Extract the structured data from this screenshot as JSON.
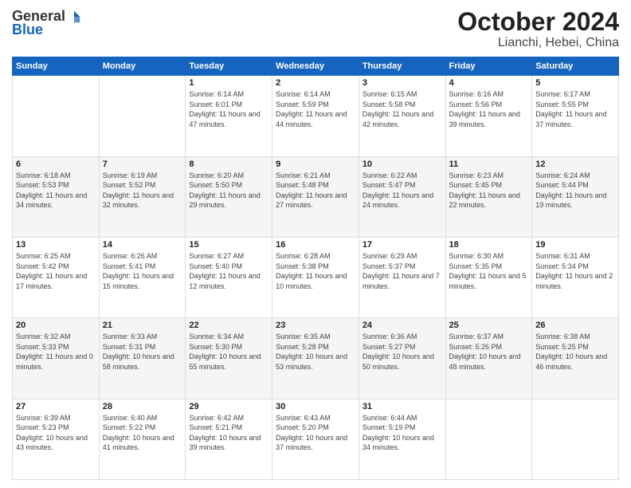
{
  "logo": {
    "general": "General",
    "blue": "Blue"
  },
  "title": "October 2024",
  "subtitle": "Lianchi, Hebei, China",
  "days_header": [
    "Sunday",
    "Monday",
    "Tuesday",
    "Wednesday",
    "Thursday",
    "Friday",
    "Saturday"
  ],
  "weeks": [
    [
      {
        "day": "",
        "info": ""
      },
      {
        "day": "",
        "info": ""
      },
      {
        "day": "1",
        "sunrise": "6:14 AM",
        "sunset": "6:01 PM",
        "daylight": "11 hours and 47 minutes."
      },
      {
        "day": "2",
        "sunrise": "6:14 AM",
        "sunset": "5:59 PM",
        "daylight": "11 hours and 44 minutes."
      },
      {
        "day": "3",
        "sunrise": "6:15 AM",
        "sunset": "5:58 PM",
        "daylight": "11 hours and 42 minutes."
      },
      {
        "day": "4",
        "sunrise": "6:16 AM",
        "sunset": "5:56 PM",
        "daylight": "11 hours and 39 minutes."
      },
      {
        "day": "5",
        "sunrise": "6:17 AM",
        "sunset": "5:55 PM",
        "daylight": "11 hours and 37 minutes."
      }
    ],
    [
      {
        "day": "6",
        "sunrise": "6:18 AM",
        "sunset": "5:53 PM",
        "daylight": "11 hours and 34 minutes."
      },
      {
        "day": "7",
        "sunrise": "6:19 AM",
        "sunset": "5:52 PM",
        "daylight": "11 hours and 32 minutes."
      },
      {
        "day": "8",
        "sunrise": "6:20 AM",
        "sunset": "5:50 PM",
        "daylight": "11 hours and 29 minutes."
      },
      {
        "day": "9",
        "sunrise": "6:21 AM",
        "sunset": "5:48 PM",
        "daylight": "11 hours and 27 minutes."
      },
      {
        "day": "10",
        "sunrise": "6:22 AM",
        "sunset": "5:47 PM",
        "daylight": "11 hours and 24 minutes."
      },
      {
        "day": "11",
        "sunrise": "6:23 AM",
        "sunset": "5:45 PM",
        "daylight": "11 hours and 22 minutes."
      },
      {
        "day": "12",
        "sunrise": "6:24 AM",
        "sunset": "5:44 PM",
        "daylight": "11 hours and 19 minutes."
      }
    ],
    [
      {
        "day": "13",
        "sunrise": "6:25 AM",
        "sunset": "5:42 PM",
        "daylight": "11 hours and 17 minutes."
      },
      {
        "day": "14",
        "sunrise": "6:26 AM",
        "sunset": "5:41 PM",
        "daylight": "11 hours and 15 minutes."
      },
      {
        "day": "15",
        "sunrise": "6:27 AM",
        "sunset": "5:40 PM",
        "daylight": "11 hours and 12 minutes."
      },
      {
        "day": "16",
        "sunrise": "6:28 AM",
        "sunset": "5:38 PM",
        "daylight": "11 hours and 10 minutes."
      },
      {
        "day": "17",
        "sunrise": "6:29 AM",
        "sunset": "5:37 PM",
        "daylight": "11 hours and 7 minutes."
      },
      {
        "day": "18",
        "sunrise": "6:30 AM",
        "sunset": "5:35 PM",
        "daylight": "11 hours and 5 minutes."
      },
      {
        "day": "19",
        "sunrise": "6:31 AM",
        "sunset": "5:34 PM",
        "daylight": "11 hours and 2 minutes."
      }
    ],
    [
      {
        "day": "20",
        "sunrise": "6:32 AM",
        "sunset": "5:33 PM",
        "daylight": "11 hours and 0 minutes."
      },
      {
        "day": "21",
        "sunrise": "6:33 AM",
        "sunset": "5:31 PM",
        "daylight": "10 hours and 58 minutes."
      },
      {
        "day": "22",
        "sunrise": "6:34 AM",
        "sunset": "5:30 PM",
        "daylight": "10 hours and 55 minutes."
      },
      {
        "day": "23",
        "sunrise": "6:35 AM",
        "sunset": "5:28 PM",
        "daylight": "10 hours and 53 minutes."
      },
      {
        "day": "24",
        "sunrise": "6:36 AM",
        "sunset": "5:27 PM",
        "daylight": "10 hours and 50 minutes."
      },
      {
        "day": "25",
        "sunrise": "6:37 AM",
        "sunset": "5:26 PM",
        "daylight": "10 hours and 48 minutes."
      },
      {
        "day": "26",
        "sunrise": "6:38 AM",
        "sunset": "5:25 PM",
        "daylight": "10 hours and 46 minutes."
      }
    ],
    [
      {
        "day": "27",
        "sunrise": "6:39 AM",
        "sunset": "5:23 PM",
        "daylight": "10 hours and 43 minutes."
      },
      {
        "day": "28",
        "sunrise": "6:40 AM",
        "sunset": "5:22 PM",
        "daylight": "10 hours and 41 minutes."
      },
      {
        "day": "29",
        "sunrise": "6:42 AM",
        "sunset": "5:21 PM",
        "daylight": "10 hours and 39 minutes."
      },
      {
        "day": "30",
        "sunrise": "6:43 AM",
        "sunset": "5:20 PM",
        "daylight": "10 hours and 37 minutes."
      },
      {
        "day": "31",
        "sunrise": "6:44 AM",
        "sunset": "5:19 PM",
        "daylight": "10 hours and 34 minutes."
      },
      {
        "day": "",
        "info": ""
      },
      {
        "day": "",
        "info": ""
      }
    ]
  ],
  "labels": {
    "sunrise": "Sunrise:",
    "sunset": "Sunset:",
    "daylight": "Daylight:"
  }
}
